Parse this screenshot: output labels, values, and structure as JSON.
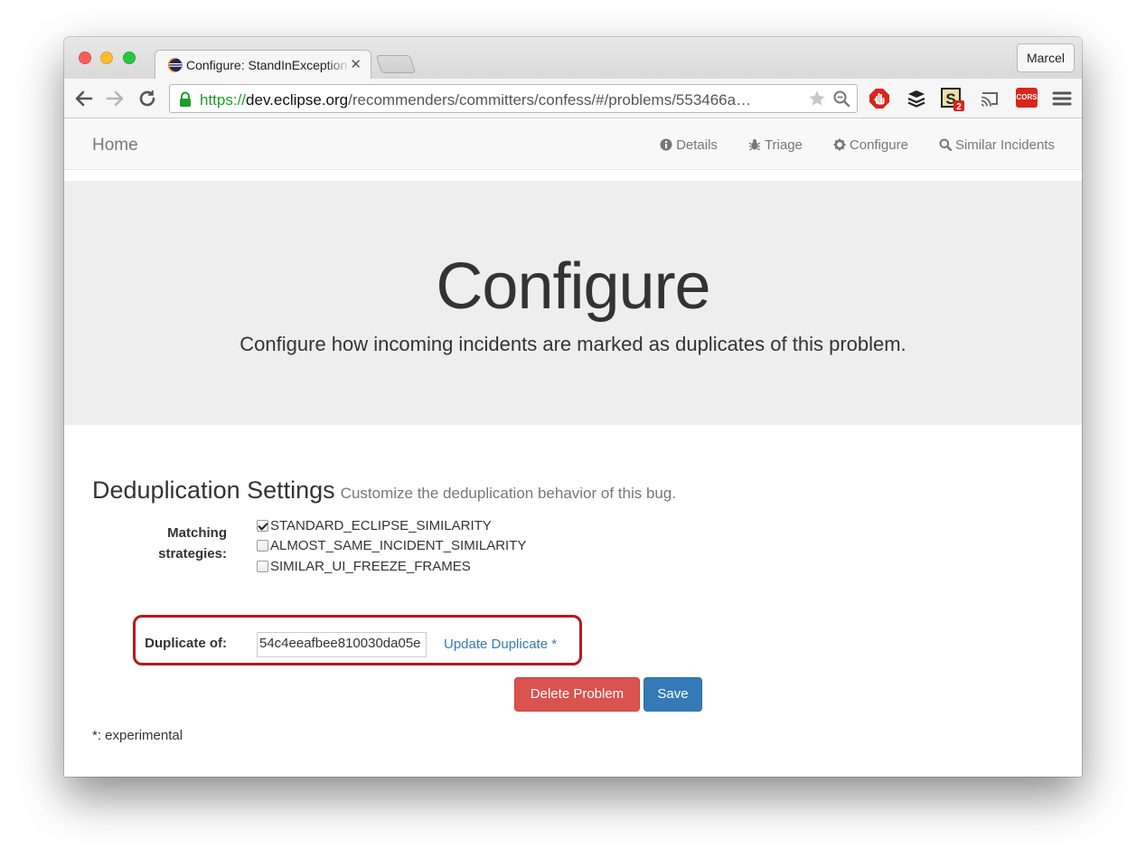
{
  "browser": {
    "tab_title": "Configure: StandInException",
    "profile_name": "Marcel",
    "url_scheme": "https://",
    "url_host": "dev.eclipse.org",
    "url_path": "/recommenders/committers/confess/#/problems/553466a…",
    "extension_badge": "2",
    "cors_label": "CORS"
  },
  "navbar": {
    "brand": "Home",
    "links": [
      {
        "label": "Details",
        "icon": "info-icon"
      },
      {
        "label": "Triage",
        "icon": "bug-icon"
      },
      {
        "label": "Configure",
        "icon": "gear-icon"
      },
      {
        "label": "Similar Incidents",
        "icon": "search-icon"
      }
    ]
  },
  "jumbotron": {
    "title": "Configure",
    "subtitle": "Configure how incoming incidents are marked as duplicates of this problem."
  },
  "dedup": {
    "title": "Deduplication Settings",
    "subtitle": "Customize the deduplication behavior of this bug.",
    "matching_label_line1": "Matching",
    "matching_label_line2": "strategies:",
    "strategies": [
      {
        "label": "STANDARD_ECLIPSE_SIMILARITY",
        "checked": true
      },
      {
        "label": "ALMOST_SAME_INCIDENT_SIMILARITY",
        "checked": false
      },
      {
        "label": "SIMILAR_UI_FREEZE_FRAMES",
        "checked": false
      }
    ],
    "duplicate_label": "Duplicate of:",
    "duplicate_value": "54c4eeafbee810030da05e",
    "update_link": "Update Duplicate *"
  },
  "buttons": {
    "delete": "Delete Problem",
    "save": "Save"
  },
  "footnote": "*: experimental",
  "colors": {
    "danger": "#d9534f",
    "primary": "#337ab7",
    "highlight": "#b81818",
    "secure_green": "#1c9c2c"
  }
}
